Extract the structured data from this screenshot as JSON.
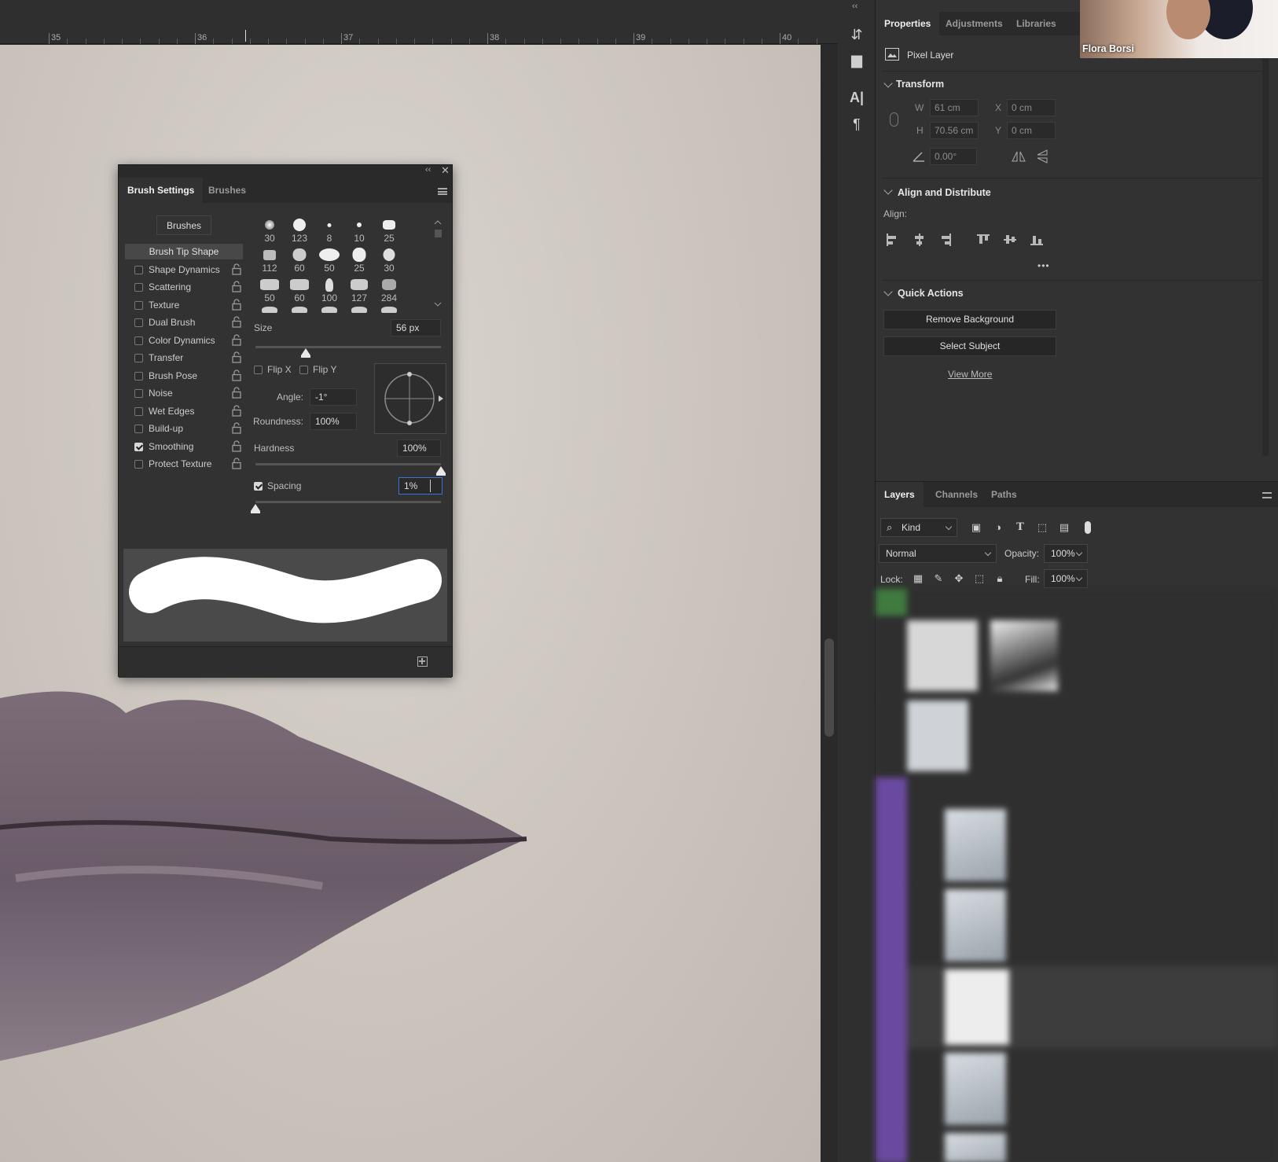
{
  "ruler": {
    "labels": [
      "35",
      "36",
      "37",
      "38",
      "39",
      "40"
    ]
  },
  "brush_panel": {
    "tabs": [
      "Brush Settings",
      "Brushes"
    ],
    "brushes_button": "Brushes",
    "options": [
      {
        "label": "Brush Tip Shape",
        "header": true
      },
      {
        "label": "Shape Dynamics",
        "checked": false
      },
      {
        "label": "Scattering",
        "checked": false
      },
      {
        "label": "Texture",
        "checked": false
      },
      {
        "label": "Dual Brush",
        "checked": false
      },
      {
        "label": "Color Dynamics",
        "checked": false
      },
      {
        "label": "Transfer",
        "checked": false
      },
      {
        "label": "Brush Pose",
        "checked": false
      },
      {
        "label": "Noise",
        "checked": false
      },
      {
        "label": "Wet Edges",
        "checked": false
      },
      {
        "label": "Build-up",
        "checked": false
      },
      {
        "label": "Smoothing",
        "checked": true
      },
      {
        "label": "Protect Texture",
        "checked": false
      }
    ],
    "tip_sizes": [
      "30",
      "123",
      "8",
      "10",
      "25",
      "112",
      "60",
      "50",
      "25",
      "30",
      "50",
      "60",
      "100",
      "127",
      "284"
    ],
    "size_label": "Size",
    "size_value": "56 px",
    "size_fraction": 0.27,
    "flip_x": "Flip X",
    "flip_y": "Flip Y",
    "angle_label": "Angle:",
    "angle_value": "-1°",
    "roundness_label": "Roundness:",
    "roundness_value": "100%",
    "hardness_label": "Hardness",
    "hardness_value": "100%",
    "hardness_fraction": 1.0,
    "spacing_label": "Spacing",
    "spacing_value": "1%",
    "spacing_fraction": 0.0
  },
  "properties": {
    "tabs": [
      "Properties",
      "Adjustments",
      "Libraries"
    ],
    "layer_type": "Pixel Layer",
    "transform_title": "Transform",
    "w_label": "W",
    "w_value": "61 cm",
    "h_label": "H",
    "h_value": "70.56 cm",
    "x_label": "X",
    "x_value": "0 cm",
    "y_label": "Y",
    "y_value": "0 cm",
    "angle_value": "0.00°",
    "align_title": "Align and Distribute",
    "align_label": "Align:",
    "more": "•••",
    "quick_title": "Quick Actions",
    "remove_bg": "Remove Background",
    "select_subject": "Select Subject",
    "view_more": "View More"
  },
  "webcam": {
    "name": "Flora Borsi"
  },
  "layers": {
    "tabs": [
      "Layers",
      "Channels",
      "Paths"
    ],
    "filter_kind": "Kind",
    "blend_mode": "Normal",
    "opacity_label": "Opacity:",
    "opacity_value": "100%",
    "lock_label": "Lock:",
    "fill_label": "Fill:",
    "fill_value": "100%",
    "group_colors": {
      "group_a": "#3f7a3f",
      "group_b": "#6a4aa0"
    }
  }
}
